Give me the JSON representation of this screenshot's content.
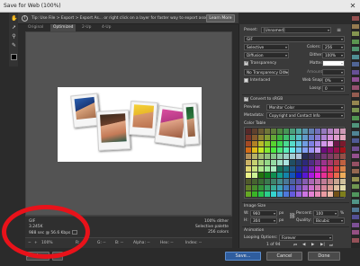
{
  "window": {
    "title": "Save for Web (100%)"
  },
  "info_bar": {
    "tip": "Tip: Use File > Export > Export As... or right click on a layer for faster way to export assets",
    "learn_more": "Learn More"
  },
  "tools": [
    "hand-icon",
    "slice-select-icon",
    "zoom-icon",
    "eyedropper-icon"
  ],
  "tabs": [
    "Original",
    "Optimized",
    "2-Up",
    "4-Up"
  ],
  "status": {
    "format": "GIF",
    "size": "3.245K",
    "time": "988 sec @ 56.6 Kbps",
    "dither": "100% dither",
    "palette": "Selective palette",
    "colors": "256 colors"
  },
  "zoombar": {
    "zoom": "100%",
    "r": "R: --",
    "g": "G: --",
    "b": "B: --",
    "alpha": "Alpha: --",
    "hex": "Hex: --",
    "index": "Index: --"
  },
  "buttons": {
    "preview": "Preview...",
    "save": "Save...",
    "cancel": "Cancel",
    "done": "Done"
  },
  "settings": {
    "preset_label": "Preset:",
    "preset_value": "[Unnamed]",
    "format": "GIF",
    "reduction": "Selective",
    "colors_label": "Colors:",
    "colors_value": "256",
    "dither_algo": "Diffusion",
    "dither_label": "Dither:",
    "dither_value": "100%",
    "transparency_label": "Transparency",
    "matte_label": "Matte:",
    "trans_dither": "No Transparency Dither",
    "amount_label": "Amount:",
    "interlaced_label": "Interlaced",
    "web_snap_label": "Web Snap:",
    "web_snap_value": "0%",
    "lossy_label": "Lossy:",
    "lossy_value": "0",
    "convert_label": "Convert to sRGB",
    "preview_label": "Preview:",
    "preview_value": "Monitor Color",
    "metadata_label": "Metadata:",
    "metadata_value": "Copyright and Contact Info",
    "color_table_label": "Color Table",
    "image_size_label": "Image Size",
    "w_label": "W:",
    "w_value": "960",
    "h_label": "H:",
    "h_value": "304",
    "px": "px",
    "percent_label": "Percent:",
    "percent_value": "100",
    "pct": "%",
    "quality_label": "Quality:",
    "quality_value": "Bicubic",
    "animation_label": "Animation",
    "looping_label": "Looping Options:",
    "looping_value": "Forever",
    "frame_counter": "1 of 94"
  },
  "colors": {
    "accent": "#2f5d9e",
    "annotation": "#e8121a",
    "panel": "#3a3a3a"
  }
}
